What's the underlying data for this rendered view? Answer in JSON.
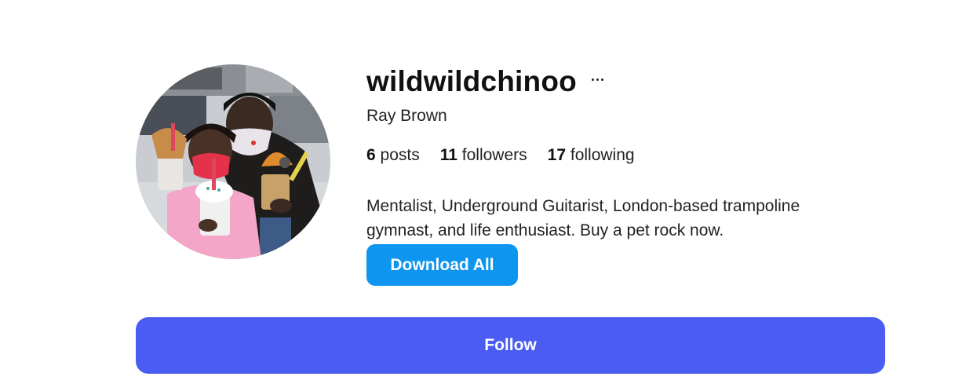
{
  "profile": {
    "username": "wildwildchinoo",
    "more_icon": "more-horizontal-icon",
    "full_name": "Ray Brown",
    "avatar_image": "profile-photo",
    "stats": {
      "posts_count": "6",
      "posts_label": "posts",
      "followers_count": "11",
      "followers_label": "followers",
      "following_count": "17",
      "following_label": "following"
    },
    "bio": "Mentalist, Underground Guitarist, London-based trampoline gymnast, and life enthusiast. Buy a pet rock now."
  },
  "actions": {
    "download_label": "Download All",
    "follow_label": "Follow"
  },
  "colors": {
    "download_button": "#0d95f0",
    "follow_button": "#4a5cf2",
    "text": "#111111"
  }
}
